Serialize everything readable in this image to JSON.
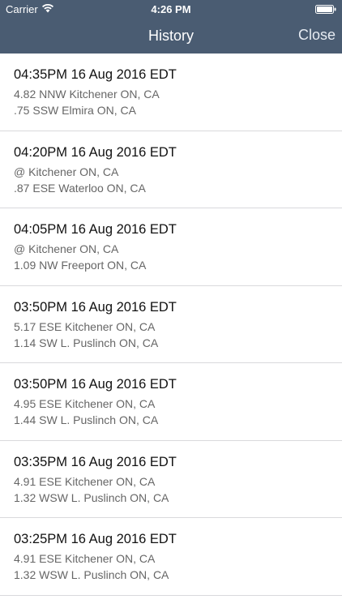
{
  "status_bar": {
    "carrier": "Carrier",
    "time": "4:26 PM"
  },
  "nav": {
    "title": "History",
    "close_label": "Close"
  },
  "colors": {
    "nav_background": "#4a5c72",
    "separator": "#d9d9dc"
  },
  "history": [
    {
      "timestamp": "04:35PM 16 Aug 2016 EDT",
      "line1": "4.82 NNW Kitchener ON, CA",
      "line2": ".75 SSW Elmira ON, CA"
    },
    {
      "timestamp": "04:20PM 16 Aug 2016 EDT",
      "line1": "@ Kitchener ON, CA",
      "line2": ".87 ESE Waterloo ON, CA"
    },
    {
      "timestamp": "04:05PM 16 Aug 2016 EDT",
      "line1": "@ Kitchener ON, CA",
      "line2": "1.09 NW Freeport ON, CA"
    },
    {
      "timestamp": "03:50PM 16 Aug 2016 EDT",
      "line1": "5.17 ESE Kitchener ON, CA",
      "line2": "1.14 SW L. Puslinch ON, CA"
    },
    {
      "timestamp": "03:50PM 16 Aug 2016 EDT",
      "line1": "4.95 ESE Kitchener ON, CA",
      "line2": "1.44 SW L. Puslinch ON, CA"
    },
    {
      "timestamp": "03:35PM 16 Aug 2016 EDT",
      "line1": "4.91 ESE Kitchener ON, CA",
      "line2": "1.32 WSW L. Puslinch ON, CA"
    },
    {
      "timestamp": "03:25PM 16 Aug 2016 EDT",
      "line1": "4.91 ESE Kitchener ON, CA",
      "line2": "1.32 WSW L. Puslinch ON, CA"
    }
  ]
}
